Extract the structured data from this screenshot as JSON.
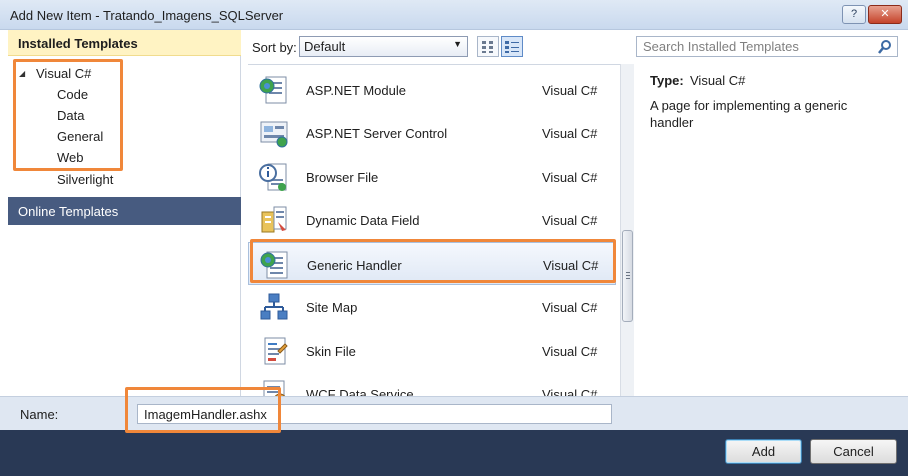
{
  "window": {
    "title": "Add New Item - Tratando_Imagens_SQLServer",
    "help_label": "?",
    "close_label": "✕"
  },
  "left_panel": {
    "installed_header": "Installed Templates",
    "tree": {
      "expander_icon": "triangle-expanded",
      "root": "Visual C#",
      "children": [
        "Code",
        "Data",
        "General",
        "Web",
        "Silverlight"
      ],
      "selected": "Web"
    },
    "online_header": "Online Templates"
  },
  "toolbar": {
    "sort_label": "Sort by:",
    "sort_value": "Default",
    "view_modes": [
      "small-icons",
      "medium-icons"
    ],
    "active_view": "medium-icons",
    "search_placeholder": "Search Installed Templates"
  },
  "templates": [
    {
      "name": "ASP.NET Module",
      "lang": "Visual C#",
      "icon": "aspnet-module-icon"
    },
    {
      "name": "ASP.NET Server Control",
      "lang": "Visual C#",
      "icon": "server-control-icon"
    },
    {
      "name": "Browser File",
      "lang": "Visual C#",
      "icon": "browser-file-icon"
    },
    {
      "name": "Dynamic Data Field",
      "lang": "Visual C#",
      "icon": "dynamic-data-field-icon"
    },
    {
      "name": "Generic Handler",
      "lang": "Visual C#",
      "icon": "generic-handler-icon",
      "selected": true
    },
    {
      "name": "Site Map",
      "lang": "Visual C#",
      "icon": "site-map-icon"
    },
    {
      "name": "Skin File",
      "lang": "Visual C#",
      "icon": "skin-file-icon"
    },
    {
      "name": "WCF Data Service",
      "lang": "Visual C#",
      "icon": "wcf-data-service-icon"
    }
  ],
  "info": {
    "type_label": "Type:",
    "type_value": "Visual C#",
    "description": "A page for implementing a generic handler"
  },
  "name_field": {
    "label": "Name:",
    "value": "ImagemHandler.ashx"
  },
  "buttons": {
    "add": "Add",
    "cancel": "Cancel"
  },
  "colors": {
    "highlight": "#f0873a",
    "installed_header_bg": "#fff3c3",
    "online_header_bg": "#475b80",
    "bottom_bar_bg": "#293955"
  }
}
